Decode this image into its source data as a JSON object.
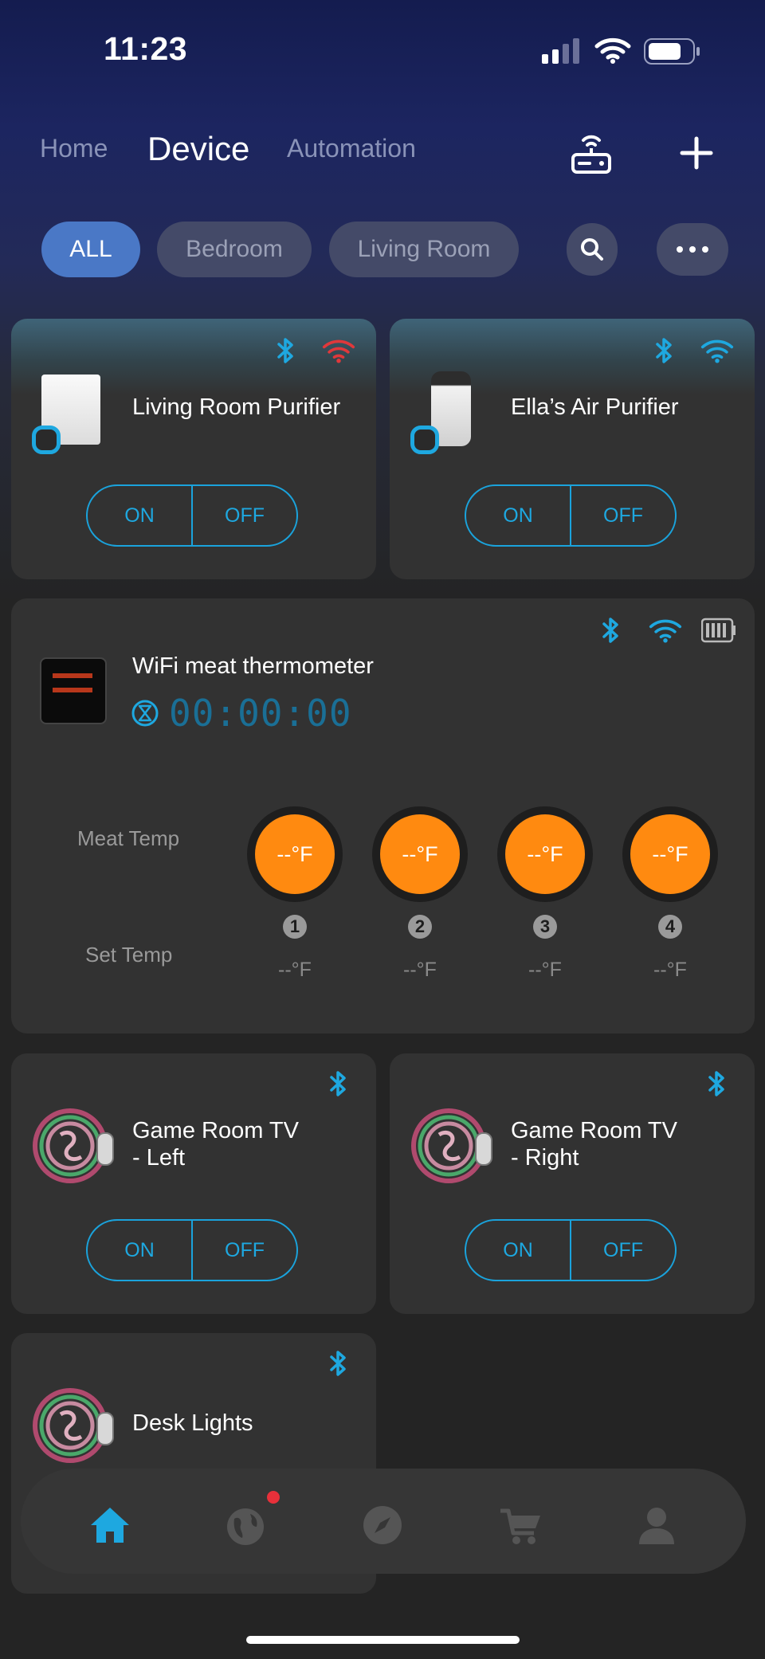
{
  "status_bar": {
    "time": "11:23"
  },
  "header": {
    "tabs": [
      {
        "label": "Home"
      },
      {
        "label": "Device"
      },
      {
        "label": "Automation"
      }
    ],
    "active_tab": "Device"
  },
  "filters": {
    "pills": [
      {
        "label": "ALL"
      },
      {
        "label": "Bedroom"
      },
      {
        "label": "Living Room"
      }
    ],
    "active": "ALL"
  },
  "devices": {
    "living_room_purifier": {
      "name": "Living Room Purifier",
      "on_label": "ON",
      "off_label": "OFF",
      "wifi_status": "disconnected"
    },
    "ellas_air_purifier": {
      "name": "Ella’s Air Purifier",
      "on_label": "ON",
      "off_label": "OFF",
      "wifi_status": "connected"
    },
    "thermometer": {
      "name": "WiFi meat thermometer",
      "timer": "00:00:00",
      "meat_temp_label": "Meat Temp",
      "set_temp_label": "Set Temp",
      "probes": [
        {
          "number": "1",
          "meat_temp": "--°F",
          "set_temp": "--°F"
        },
        {
          "number": "2",
          "meat_temp": "--°F",
          "set_temp": "--°F"
        },
        {
          "number": "3",
          "meat_temp": "--°F",
          "set_temp": "--°F"
        },
        {
          "number": "4",
          "meat_temp": "--°F",
          "set_temp": "--°F"
        }
      ]
    },
    "game_room_tv_left": {
      "name_line1": "Game Room TV",
      "name_line2": "- Left",
      "on_label": "ON",
      "off_label": "OFF"
    },
    "game_room_tv_right": {
      "name_line1": "Game Room TV",
      "name_line2": "- Right",
      "on_label": "ON",
      "off_label": "OFF"
    },
    "desk_lights": {
      "name": "Desk Lights"
    }
  },
  "bottom_nav": {
    "items": [
      {
        "icon": "home-icon",
        "active": true
      },
      {
        "icon": "globe-icon",
        "badge": true
      },
      {
        "icon": "compass-icon"
      },
      {
        "icon": "cart-icon"
      },
      {
        "icon": "profile-icon"
      }
    ]
  },
  "colors": {
    "accent": "#1ea8e0",
    "active_pill": "#4a78c6",
    "probe": "#ff8a10",
    "wifi_error": "#e0383b",
    "badge": "#e8303a"
  }
}
